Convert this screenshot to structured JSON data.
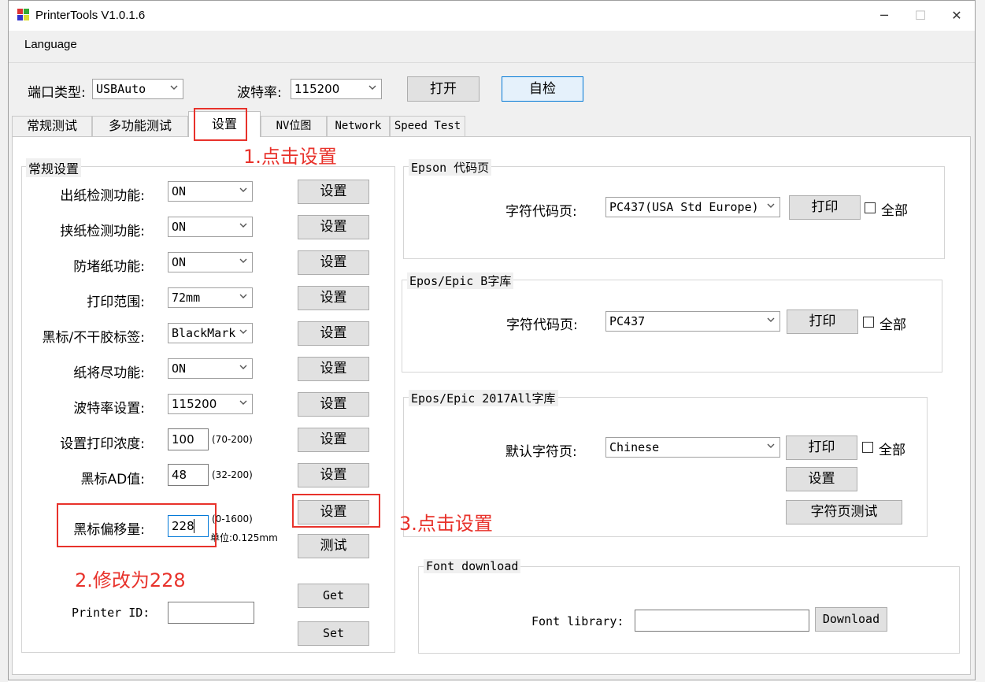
{
  "window": {
    "title": "PrinterTools V1.0.1.6",
    "minimize": "─",
    "maximize": "☐",
    "close": "✕"
  },
  "menu": {
    "language": "Language"
  },
  "top": {
    "port_label": "端口类型:",
    "port_value": "USBAuto",
    "baud_label": "波特率:",
    "baud_value": "115200",
    "open_label": "打开",
    "selftest_label": "自检"
  },
  "tabs": [
    {
      "label": "常规测试"
    },
    {
      "label": "多功能测试"
    },
    {
      "label": "设置"
    },
    {
      "label": "NV位图"
    },
    {
      "label": "Network"
    },
    {
      "label": "Speed Test"
    }
  ],
  "general": {
    "title": "常规设置",
    "set_label": "设置",
    "rows": [
      {
        "label": "出纸检测功能:",
        "value": "ON"
      },
      {
        "label": "挟纸检测功能:",
        "value": "ON"
      },
      {
        "label": "防堵纸功能:",
        "value": "ON"
      },
      {
        "label": "打印范围:",
        "value": "72mm"
      },
      {
        "label": "黑标/不干胶标签:",
        "value": "BlackMark"
      },
      {
        "label": "纸将尽功能:",
        "value": "ON"
      },
      {
        "label": "波特率设置:",
        "value": "115200"
      }
    ],
    "density_label": "设置打印浓度:",
    "density_value": "100",
    "density_range": "(70-200)",
    "ad_label": "黑标AD值:",
    "ad_value": "48",
    "ad_range": "(32-200)",
    "offset_label": "黑标偏移量:",
    "offset_value": "228",
    "offset_range": "(0-1600)",
    "offset_unit": "单位:0.125mm",
    "test_label": "测试",
    "get_label": "Get",
    "printer_id_label": "Printer ID:",
    "set_en_label": "Set"
  },
  "epson": {
    "title": "Epson 代码页",
    "label": "字符代码页:",
    "value": "PC437(USA Std Europe)",
    "print_label": "打印",
    "all_label": "全部"
  },
  "epos_b": {
    "title": "Epos/Epic B字库",
    "label": "字符代码页:",
    "value": "PC437",
    "print_label": "打印",
    "all_label": "全部"
  },
  "epos_2017": {
    "title": "Epos/Epic 2017All字库",
    "label": "默认字符页:",
    "value": "Chinese",
    "print_label": "打印",
    "all_label": "全部",
    "set_label": "设置",
    "test_label": "字符页测试"
  },
  "font_download": {
    "title": "Font download",
    "library_label": "Font library:",
    "library_value": "",
    "download_label": "Download"
  },
  "annotations": {
    "step1": "1.点击设置",
    "step2": "2.修改为228",
    "step3": "3.点击设置"
  },
  "colors": {
    "annotation": "#e8322b",
    "focus": "#0078d7"
  }
}
